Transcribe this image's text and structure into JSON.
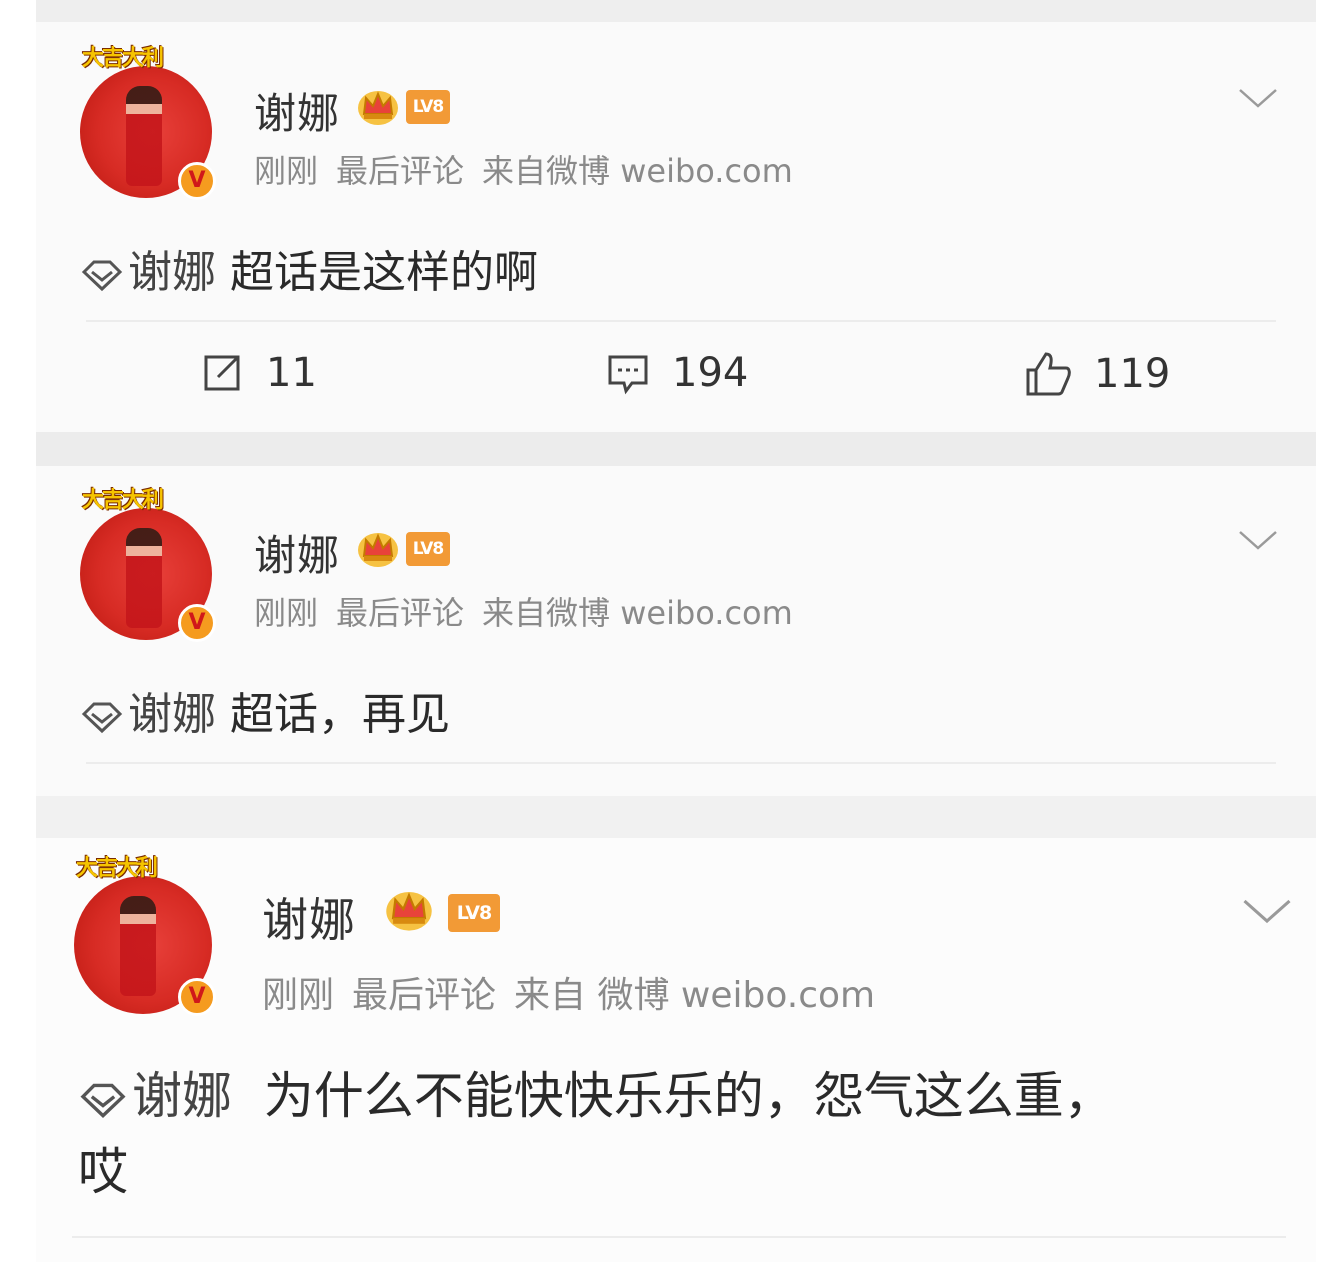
{
  "posts": [
    {
      "username": "谢娜",
      "level": "LV8",
      "time": "刚刚",
      "last_comment": "最后评论",
      "source": "来自微博 weibo.com",
      "supertopic": "谢娜",
      "text": "超话是这样的啊",
      "avatar_banner": "大吉大利",
      "verified": "V",
      "actions": {
        "repost": "11",
        "comment": "194",
        "like": "119"
      }
    },
    {
      "username": "谢娜",
      "level": "LV8",
      "time": "刚刚",
      "last_comment": "最后评论",
      "source": "来自微博 weibo.com",
      "supertopic": "谢娜",
      "text": "超话，再见",
      "avatar_banner": "大吉大利",
      "verified": "V"
    },
    {
      "username": "谢娜",
      "level": "LV8",
      "time": "刚刚",
      "last_comment": "最后评论",
      "source": "来自 微博 weibo.com",
      "supertopic": "谢娜",
      "text": "为什么不能快快乐乐的，怨气这么重，",
      "text_line2": "哎",
      "avatar_banner": "大吉大利",
      "verified": "V"
    }
  ],
  "colors": {
    "accent": "#f29a36",
    "avatar_red": "#d72b24",
    "meta_gray": "#8a8a8a"
  },
  "icons": [
    "chevron-down-icon",
    "supertopic-diamond-icon",
    "crown-icon",
    "repost-icon",
    "comment-icon",
    "like-icon",
    "verified-icon"
  ]
}
